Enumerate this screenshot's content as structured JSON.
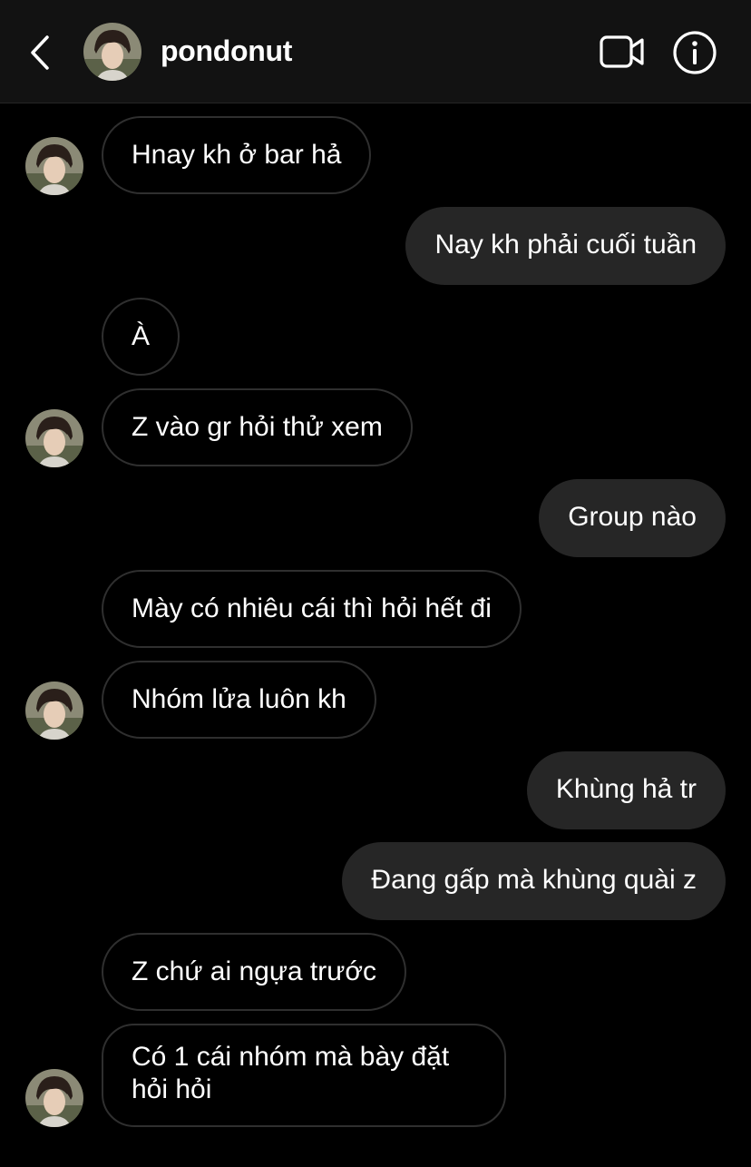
{
  "header": {
    "username": "pondonut"
  },
  "icons": {
    "back": "chevron-left-icon",
    "video": "video-camera-icon",
    "info": "info-circle-icon",
    "avatar": "profile-photo"
  },
  "colors": {
    "background": "#000000",
    "header_background": "#121212",
    "outgoing_bubble": "#262626",
    "incoming_bubble_border": "#2f2f2f",
    "text": "#ffffff"
  },
  "messages": [
    {
      "direction": "in",
      "text": "Hnay kh ở bar hả"
    },
    {
      "direction": "out",
      "text": "Nay kh phải cuối tuần"
    },
    {
      "direction": "in",
      "text": "À"
    },
    {
      "direction": "in",
      "text": "Z vào gr hỏi thử xem"
    },
    {
      "direction": "out",
      "text": "Group nào"
    },
    {
      "direction": "in",
      "text": "Mày có nhiêu cái thì hỏi hết đi"
    },
    {
      "direction": "in",
      "text": "Nhóm lửa luôn kh"
    },
    {
      "direction": "out",
      "text": "Khùng hả tr"
    },
    {
      "direction": "out",
      "text": "Đang gấp mà khùng quài z"
    },
    {
      "direction": "in",
      "text": "Z chứ ai ngựa trước"
    },
    {
      "direction": "in",
      "text": "Có 1 cái nhóm mà bày đặt hỏi hỏi"
    }
  ]
}
